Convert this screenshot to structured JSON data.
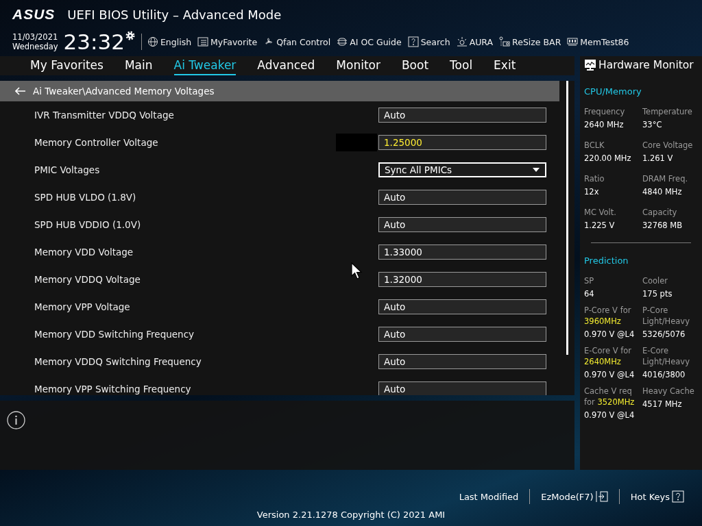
{
  "header": {
    "logo": "ASUS",
    "title": "UEFI BIOS Utility – Advanced Mode",
    "date": "11/03/2021",
    "weekday": "Wednesday",
    "time": "23:32",
    "tools": [
      {
        "label": "English"
      },
      {
        "label": "MyFavorite"
      },
      {
        "label": "Qfan Control"
      },
      {
        "label": "AI OC Guide"
      },
      {
        "label": "Search"
      },
      {
        "label": "AURA"
      },
      {
        "label": "ReSize BAR"
      },
      {
        "label": "MemTest86"
      }
    ]
  },
  "tabs": [
    {
      "label": "My Favorites",
      "selected": false
    },
    {
      "label": "Main",
      "selected": false
    },
    {
      "label": "Ai Tweaker",
      "selected": true
    },
    {
      "label": "Advanced",
      "selected": false
    },
    {
      "label": "Monitor",
      "selected": false
    },
    {
      "label": "Boot",
      "selected": false
    },
    {
      "label": "Tool",
      "selected": false
    },
    {
      "label": "Exit",
      "selected": false
    }
  ],
  "breadcrumb": "Ai Tweaker\\Advanced Memory Voltages",
  "settings": [
    {
      "label": "IVR Transmitter VDDQ Voltage",
      "value": "Auto",
      "kind": "field",
      "selected": false
    },
    {
      "label": "Memory Controller Voltage",
      "value": "1.25000",
      "kind": "field",
      "selected": true
    },
    {
      "label": "PMIC Voltages",
      "value": "Sync All PMICs",
      "kind": "dropdown",
      "selected": false
    },
    {
      "label": "SPD HUB VLDO (1.8V)",
      "value": "Auto",
      "kind": "field",
      "selected": false
    },
    {
      "label": "SPD HUB VDDIO (1.0V)",
      "value": "Auto",
      "kind": "field",
      "selected": false
    },
    {
      "label": "Memory VDD Voltage",
      "value": "1.33000",
      "kind": "field",
      "selected": false
    },
    {
      "label": "Memory VDDQ Voltage",
      "value": "1.32000",
      "kind": "field",
      "selected": false
    },
    {
      "label": "Memory VPP Voltage",
      "value": "Auto",
      "kind": "field",
      "selected": false
    },
    {
      "label": "Memory VDD Switching Frequency",
      "value": "Auto",
      "kind": "field",
      "selected": false
    },
    {
      "label": "Memory VDDQ Switching Frequency",
      "value": "Auto",
      "kind": "field",
      "selected": false
    },
    {
      "label": "Memory VPP Switching Frequency",
      "value": "Auto",
      "kind": "field",
      "selected": false
    }
  ],
  "hardware_monitor": {
    "title": "Hardware Monitor",
    "cpu_memory": {
      "title": "CPU/Memory",
      "items": [
        {
          "label": "Frequency",
          "value": "2640 MHz"
        },
        {
          "label": "Temperature",
          "value": "33°C"
        },
        {
          "label": "BCLK",
          "value": "220.00 MHz"
        },
        {
          "label": "Core Voltage",
          "value": "1.261 V"
        },
        {
          "label": "Ratio",
          "value": "12x"
        },
        {
          "label": "DRAM Freq.",
          "value": "4840 MHz"
        },
        {
          "label": "MC Volt.",
          "value": "1.225 V"
        },
        {
          "label": "Capacity",
          "value": "32768 MB"
        }
      ]
    },
    "prediction": {
      "title": "Prediction",
      "items": [
        {
          "label": "SP",
          "value": "64"
        },
        {
          "label": "Cooler",
          "value": "175 pts"
        },
        {
          "label": "P-Core V for",
          "highlight": "3960MHz",
          "value": "0.970 V @L4"
        },
        {
          "label": "P-Core Light/Heavy",
          "value": "5326/5076"
        },
        {
          "label": "E-Core V for",
          "highlight": "2640MHz",
          "value": "0.970 V @L4"
        },
        {
          "label": "E-Core Light/Heavy",
          "value": "4016/3800"
        },
        {
          "label": "Cache V req for",
          "highlight": "3520MHz",
          "value": "0.970 V @L4"
        },
        {
          "label": "Heavy Cache",
          "value": "4517 MHz"
        }
      ]
    }
  },
  "footer": {
    "actions": [
      {
        "label": "Last Modified"
      },
      {
        "label": "EzMode(F7)"
      },
      {
        "label": "Hot Keys"
      }
    ],
    "version": "Version 2.21.1278 Copyright (C) 2021 AMI"
  }
}
